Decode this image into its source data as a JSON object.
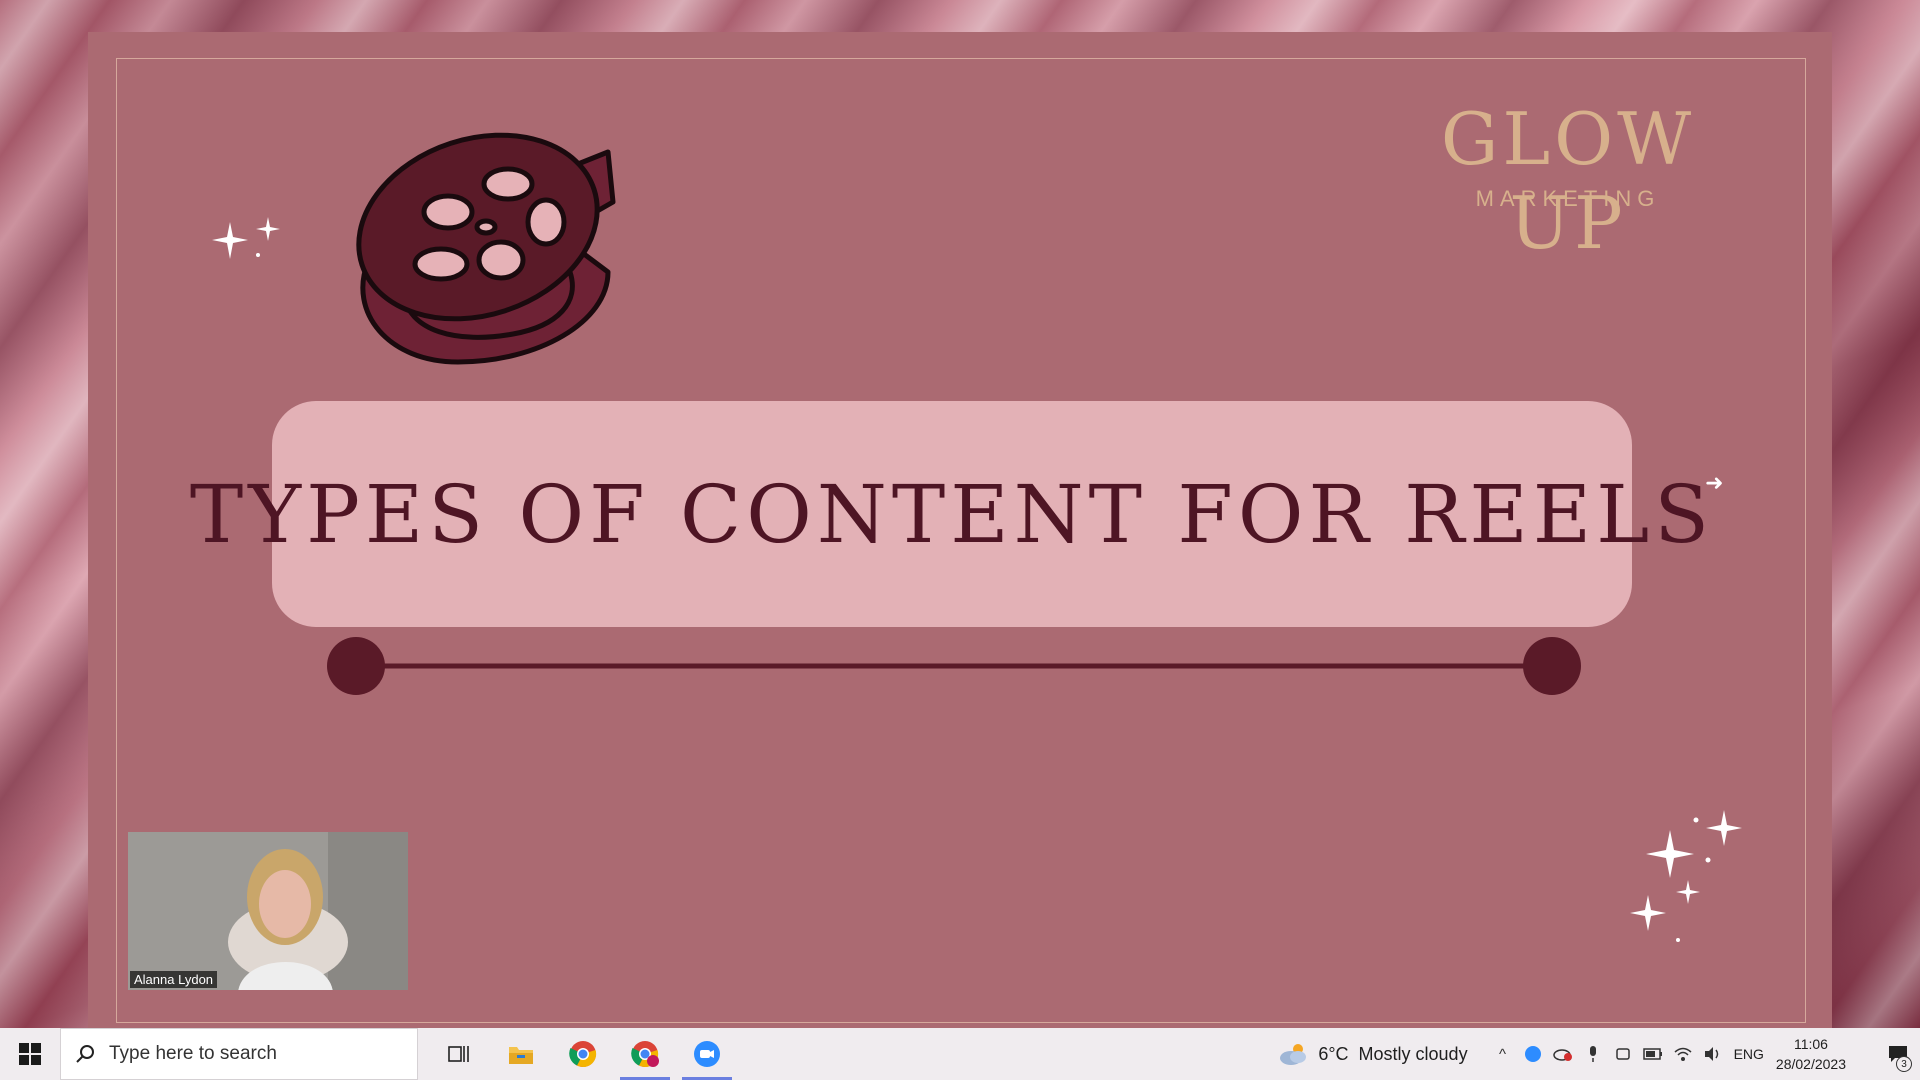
{
  "slide": {
    "logo_title": "GLOW UP",
    "logo_subtitle": "MARKETING",
    "heading": "TYPES OF CONTENT FOR REELS"
  },
  "video": {
    "participant_name": "Alanna Lydon"
  },
  "taskbar": {
    "search_placeholder": "Type here to search",
    "pinned_icons": [
      "task-view-icon",
      "file-explorer-icon",
      "chrome-icon",
      "chrome-profile-icon",
      "zoom-icon"
    ],
    "weather_temp": "6°C",
    "weather_desc": "Mostly cloudy",
    "language": "ENG",
    "time": "11:06",
    "date": "28/02/2023",
    "notification_count": "3"
  },
  "colors": {
    "slide_bg": "#ab6a72",
    "banner_bg": "#e3b1b6",
    "title_text": "#4e1524",
    "logo_gold": "#d7b08c",
    "reel_dark": "#5a1a28"
  }
}
